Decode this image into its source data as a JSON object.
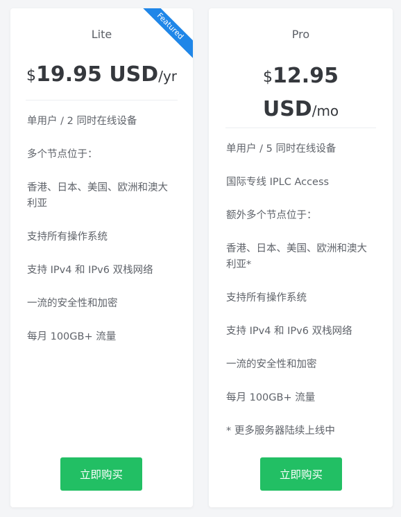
{
  "plans": [
    {
      "name": "Lite",
      "ribbon": "Featured",
      "currency": "$",
      "amount": "19.95 USD",
      "period": "/yr",
      "features": [
        "单用户 / 2 同时在线设备",
        "多个节点位于：",
        "香港、日本、美国、欧洲和澳大利亚",
        "支持所有操作系统",
        "支持 IPv4 和 IPv6 双栈网络",
        "一流的安全性和加密",
        "每月 100GB+ 流量"
      ],
      "button": "立即购买"
    },
    {
      "name": "Pro",
      "currency": "$",
      "amount": "12.95 USD",
      "period": "/mo",
      "features": [
        "单用户 / 5 同时在线设备",
        "国际专线 IPLC Access",
        "额外多个节点位于：",
        "香港、日本、美国、欧洲和澳大利亚*",
        "支持所有操作系统",
        "支持 IPv4 和 IPv6 双栈网络",
        "一流的安全性和加密",
        "每月 100GB+ 流量",
        "* 更多服务器陆续上线中"
      ],
      "button": "立即购买"
    }
  ],
  "colors": {
    "ribbon": "#1f86e8",
    "button": "#22bf64"
  }
}
